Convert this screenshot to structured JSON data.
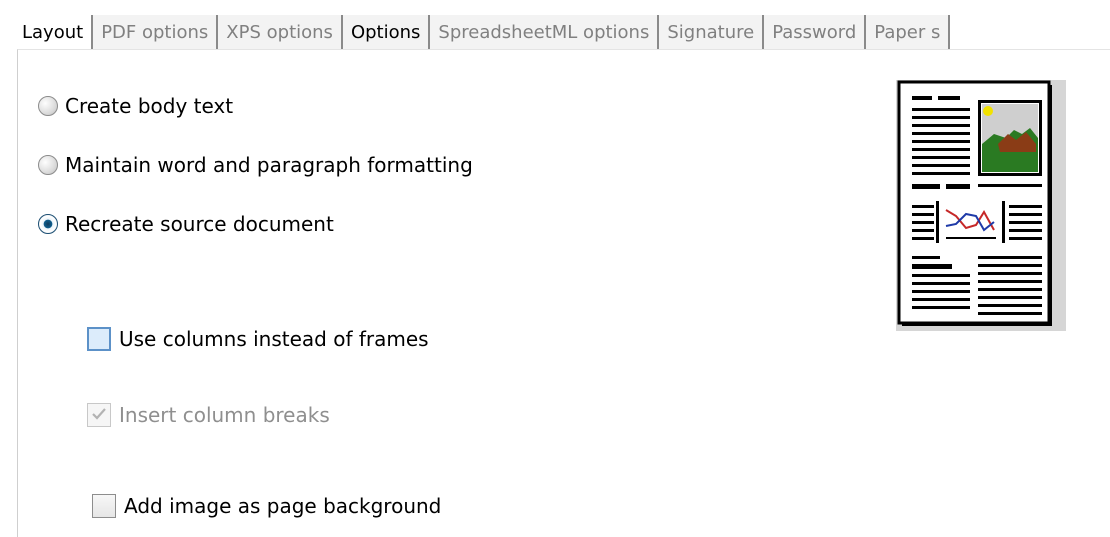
{
  "tabs": [
    {
      "label": "Layout",
      "state": "active"
    },
    {
      "label": "PDF options",
      "state": "dim"
    },
    {
      "label": "XPS options",
      "state": "dim"
    },
    {
      "label": "Options",
      "state": "dark"
    },
    {
      "label": "SpreadsheetML options",
      "state": "dim"
    },
    {
      "label": "Signature",
      "state": "dim"
    },
    {
      "label": "Password",
      "state": "dim"
    },
    {
      "label": "Paper s",
      "state": "dim"
    }
  ],
  "layout_options": {
    "create_body_text": {
      "label": "Create body text",
      "selected": false
    },
    "maintain_formatting": {
      "label": "Maintain word and paragraph formatting",
      "selected": false
    },
    "recreate_source": {
      "label": "Recreate source document",
      "selected": true
    }
  },
  "checkboxes": {
    "use_columns": {
      "label": "Use columns instead of frames",
      "checked": false,
      "enabled": true,
      "focused": true
    },
    "insert_breaks": {
      "label": "Insert column breaks",
      "checked": true,
      "enabled": false
    },
    "add_image_background": {
      "label": "Add image as page background",
      "checked": false,
      "enabled": true
    }
  },
  "preview": {
    "icon": "document-layout-preview-icon"
  },
  "colors": {
    "checkbox_focus": "#5c91c8",
    "radio_selected": "#0f5f8f",
    "disabled_text": "#8f8f8f"
  }
}
